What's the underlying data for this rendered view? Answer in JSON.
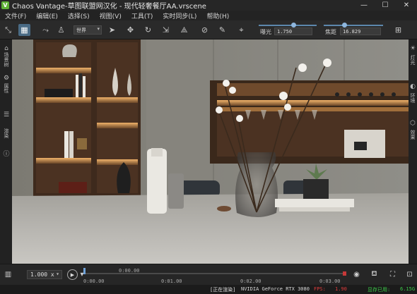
{
  "window": {
    "app_icon": "V",
    "title": "Chaos Vantage-草图联盟网汉化 - 现代轻奢餐厅AA.vrscene",
    "minimize": "—",
    "maximize": "☐",
    "close": "✕"
  },
  "menu": [
    "文件(F)",
    "编辑(E)",
    "选择(S)",
    "视图(V)",
    "工具(T)",
    "实时同步(L)",
    "帮助(H)"
  ],
  "toolbar": {
    "camera_select": "世界",
    "exposure_label": "曝光",
    "exposure_value": "1.750",
    "exposure_level": 0.6,
    "focus_label": "焦距",
    "focus_value": "16.829",
    "focus_level": 0.35,
    "icons": [
      "selection-tool-icon",
      "camera-view-icon",
      "walk-icon",
      "person-icon",
      "pointer-icon",
      "move-icon",
      "rotate-icon",
      "scale-icon",
      "camera-path-icon",
      "material-picker-icon",
      "brush-icon",
      "target-icon",
      "screenshot-icon"
    ]
  },
  "left_panel": {
    "items": [
      {
        "label": "场景树",
        "icon": "scene-tree-icon"
      },
      {
        "label": "属性",
        "icon": "properties-icon"
      },
      {
        "label": "渲染",
        "icon": "render-settings-icon"
      }
    ]
  },
  "right_panel": {
    "items": [
      {
        "label": "灯光",
        "icon": "light-icon"
      },
      {
        "label": "环境",
        "icon": "environment-icon"
      },
      {
        "label": "效果",
        "icon": "effects-icon"
      }
    ]
  },
  "timeline": {
    "speed": "1.000 x",
    "time_top": "0:00.00",
    "ticks": [
      "0:00.00",
      "0:01.00",
      "0:02.00",
      "0:03.00"
    ],
    "cursor_position": 0.0,
    "icons": [
      "record-icon",
      "teapot-icon",
      "fullscreen-icon",
      "snapshot-icon"
    ]
  },
  "status": {
    "state": "[正在渲染]",
    "gpu": "NVIDIA GeForce RTX 3080",
    "fps_label": "FPS:",
    "fps_value": "1.90",
    "time_label": "显存已用:",
    "time_value": "6.15G",
    "colors": {
      "fps": "#e03c3c",
      "memory": "#3ccc4a"
    }
  }
}
